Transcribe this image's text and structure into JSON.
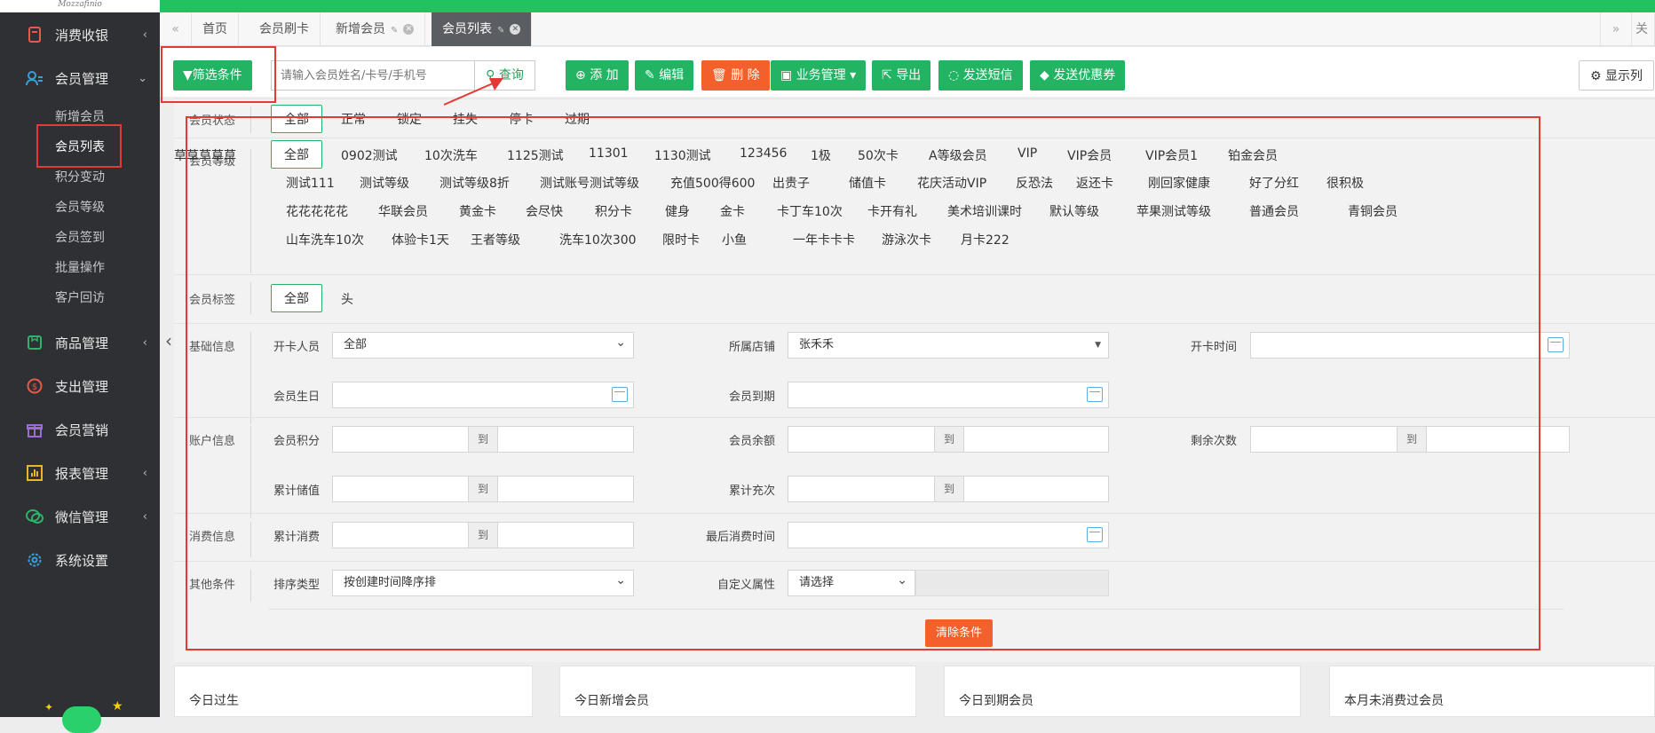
{
  "sidebar": {
    "logo": "Mozzafinio",
    "menu": [
      {
        "label": "消费收银",
        "icon": "cashier-icon"
      },
      {
        "label": "会员管理",
        "icon": "members-icon",
        "expanded": true
      },
      {
        "label": "商品管理",
        "icon": "goods-icon"
      },
      {
        "label": "支出管理",
        "icon": "expense-icon"
      },
      {
        "label": "会员营销",
        "icon": "gift-icon"
      },
      {
        "label": "报表管理",
        "icon": "report-icon"
      },
      {
        "label": "微信管理",
        "icon": "wechat-icon"
      },
      {
        "label": "系统设置",
        "icon": "gear-icon"
      }
    ],
    "submenu": [
      "新增会员",
      "会员列表",
      "积分变动",
      "会员等级",
      "会员签到",
      "批量操作",
      "客户回访"
    ],
    "selected_sub": "会员列表"
  },
  "tabs": {
    "items": [
      "首页",
      "会员刷卡",
      "新增会员",
      "会员列表"
    ],
    "active": "会员列表",
    "right_label": "关"
  },
  "toolbar": {
    "filter_label": "筛选条件",
    "search_placeholder": "请输入会员姓名/卡号/手机号",
    "search_label": "查询",
    "add": "添 加",
    "edit": "编辑",
    "delete": "删 除",
    "business": "业务管理",
    "export": "导出",
    "sms": "发送短信",
    "coupon": "发送优惠券",
    "columns": "显示列"
  },
  "filters": {
    "status": {
      "label": "会员状态",
      "options": [
        "全部",
        "正常",
        "锁定",
        "挂失",
        "停卡",
        "过期"
      ]
    },
    "level": {
      "label": "会员等级",
      "rows": [
        [
          "全部",
          "0902测试",
          "10次洗车",
          "1125测试",
          "11301",
          "1130测试",
          "123456",
          "1极",
          "50次卡",
          "A等级会员",
          "VIP",
          "VIP会员",
          "VIP会员1",
          "铂金会员",
          "草草草草草"
        ],
        [
          "测试111",
          "测试等级",
          "测试等级8折",
          "测试账号测试等级",
          "充值500得600",
          "出贵子",
          "储值卡",
          "花庆活动VIP",
          "反恐法",
          "返还卡",
          "刚回家健康",
          "好了分红",
          "很积极"
        ],
        [
          "花花花花花",
          "华联会员",
          "黄金卡",
          "会尽快",
          "积分卡",
          "健身",
          "金卡",
          "卡丁车10次",
          "卡开有礼",
          "美术培训课时",
          "默认等级",
          "苹果测试等级",
          "普通会员",
          "青铜会员"
        ],
        [
          "山车洗车10次",
          "体验卡1天",
          "王者等级",
          "洗车10次300",
          "限时卡",
          "小鱼",
          "一年卡卡卡",
          "游泳次卡",
          "月卡222"
        ]
      ]
    },
    "tag": {
      "label": "会员标签",
      "options": [
        "全部",
        "头"
      ]
    },
    "basic": {
      "label": "基础信息",
      "opener_label": "开卡人员",
      "opener_value": "全部",
      "store_label": "所属店铺",
      "store_value": "张禾禾",
      "open_time_label": "开卡时间",
      "birthday_label": "会员生日",
      "expire_label": "会员到期"
    },
    "account": {
      "label": "账户信息",
      "points_label": "会员积分",
      "balance_label": "会员余额",
      "remain_label": "剩余次数",
      "stored_label": "累计储值",
      "recharge_label": "累计充次",
      "to": "到"
    },
    "consume": {
      "label": "消费信息",
      "total_label": "累计消费",
      "last_label": "最后消费时间"
    },
    "other": {
      "label": "其他条件",
      "sort_label": "排序类型",
      "sort_value": "按创建时间降序排",
      "custom_label": "自定义属性",
      "custom_value": "请选择"
    },
    "clear": "清除条件"
  },
  "stats": [
    "今日过生",
    "今日新增会员",
    "今日到期会员",
    "本月未消费过会员"
  ],
  "colors": {
    "green": "#22b463",
    "orange": "#f4602b",
    "sidebar": "#2f3033",
    "annotation": "#e53935"
  }
}
